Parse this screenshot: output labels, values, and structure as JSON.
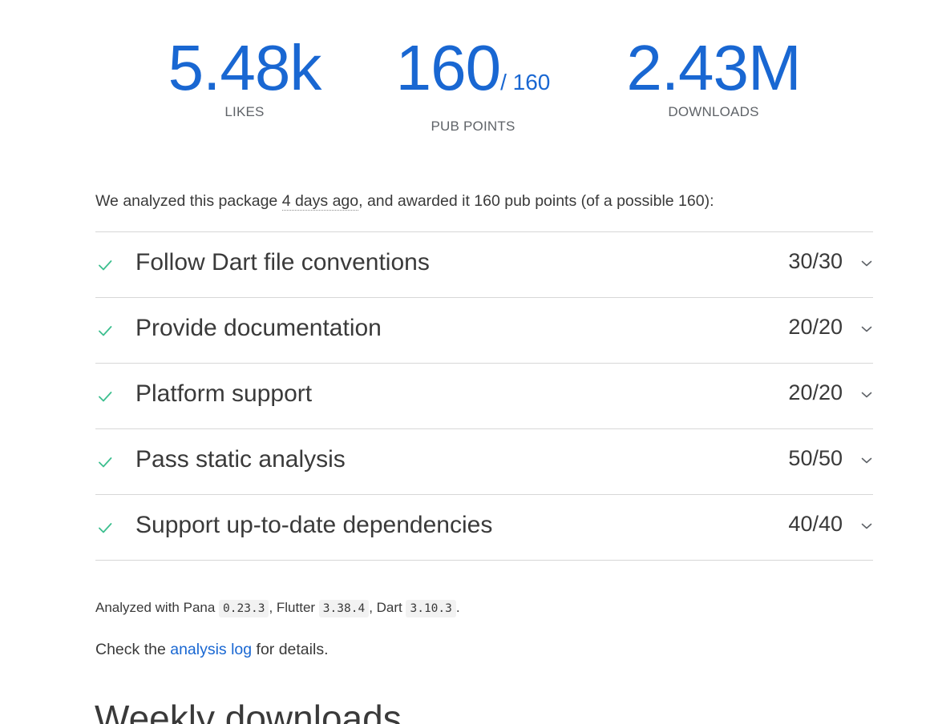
{
  "scores": {
    "likes": {
      "value": "5.48k",
      "label": "LIKES"
    },
    "pub_points": {
      "value": "160",
      "max": "/ 160",
      "label": "PUB POINTS"
    },
    "downloads": {
      "value": "2.43M",
      "label": "DOWNLOADS"
    }
  },
  "summary": {
    "prefix": "We analyzed this package ",
    "time_ago": "4 days ago",
    "suffix": ", and awarded it 160 pub points (of a possible 160):"
  },
  "sections": [
    {
      "title": "Follow Dart file conventions",
      "score": "30/30"
    },
    {
      "title": "Provide documentation",
      "score": "20/20"
    },
    {
      "title": "Platform support",
      "score": "20/20"
    },
    {
      "title": "Pass static analysis",
      "score": "50/50"
    },
    {
      "title": "Support up-to-date dependencies",
      "score": "40/40"
    }
  ],
  "icons": {
    "check": "check-icon",
    "expand": "chevron-down-icon"
  },
  "analyzed": {
    "prefix": "Analyzed with Pana ",
    "pana_version": "0.23.3",
    "flutter_label": ", Flutter ",
    "flutter_version": "3.38.4",
    "dart_label": ", Dart ",
    "dart_version": "3.10.3",
    "end": "."
  },
  "log": {
    "prefix": "Check the ",
    "link_text": "analysis log",
    "suffix": " for details."
  },
  "weekly_heading": "Weekly downloads",
  "colors": {
    "accent": "#1967d2",
    "check": "#3dbf8f",
    "text": "#3a3a3a"
  }
}
